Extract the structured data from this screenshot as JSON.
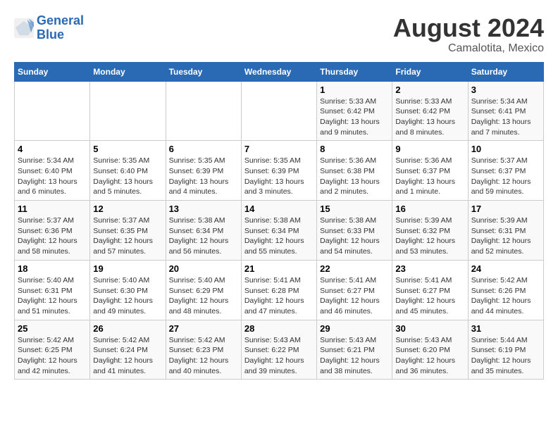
{
  "header": {
    "logo_line1": "General",
    "logo_line2": "Blue",
    "title": "August 2024",
    "subtitle": "Camalotita, Mexico"
  },
  "days_of_week": [
    "Sunday",
    "Monday",
    "Tuesday",
    "Wednesday",
    "Thursday",
    "Friday",
    "Saturday"
  ],
  "weeks": [
    [
      {
        "day": "",
        "info": ""
      },
      {
        "day": "",
        "info": ""
      },
      {
        "day": "",
        "info": ""
      },
      {
        "day": "",
        "info": ""
      },
      {
        "day": "1",
        "info": "Sunrise: 5:33 AM\nSunset: 6:42 PM\nDaylight: 13 hours\nand 9 minutes."
      },
      {
        "day": "2",
        "info": "Sunrise: 5:33 AM\nSunset: 6:42 PM\nDaylight: 13 hours\nand 8 minutes."
      },
      {
        "day": "3",
        "info": "Sunrise: 5:34 AM\nSunset: 6:41 PM\nDaylight: 13 hours\nand 7 minutes."
      }
    ],
    [
      {
        "day": "4",
        "info": "Sunrise: 5:34 AM\nSunset: 6:40 PM\nDaylight: 13 hours\nand 6 minutes."
      },
      {
        "day": "5",
        "info": "Sunrise: 5:35 AM\nSunset: 6:40 PM\nDaylight: 13 hours\nand 5 minutes."
      },
      {
        "day": "6",
        "info": "Sunrise: 5:35 AM\nSunset: 6:39 PM\nDaylight: 13 hours\nand 4 minutes."
      },
      {
        "day": "7",
        "info": "Sunrise: 5:35 AM\nSunset: 6:39 PM\nDaylight: 13 hours\nand 3 minutes."
      },
      {
        "day": "8",
        "info": "Sunrise: 5:36 AM\nSunset: 6:38 PM\nDaylight: 13 hours\nand 2 minutes."
      },
      {
        "day": "9",
        "info": "Sunrise: 5:36 AM\nSunset: 6:37 PM\nDaylight: 13 hours\nand 1 minute."
      },
      {
        "day": "10",
        "info": "Sunrise: 5:37 AM\nSunset: 6:37 PM\nDaylight: 12 hours\nand 59 minutes."
      }
    ],
    [
      {
        "day": "11",
        "info": "Sunrise: 5:37 AM\nSunset: 6:36 PM\nDaylight: 12 hours\nand 58 minutes."
      },
      {
        "day": "12",
        "info": "Sunrise: 5:37 AM\nSunset: 6:35 PM\nDaylight: 12 hours\nand 57 minutes."
      },
      {
        "day": "13",
        "info": "Sunrise: 5:38 AM\nSunset: 6:34 PM\nDaylight: 12 hours\nand 56 minutes."
      },
      {
        "day": "14",
        "info": "Sunrise: 5:38 AM\nSunset: 6:34 PM\nDaylight: 12 hours\nand 55 minutes."
      },
      {
        "day": "15",
        "info": "Sunrise: 5:38 AM\nSunset: 6:33 PM\nDaylight: 12 hours\nand 54 minutes."
      },
      {
        "day": "16",
        "info": "Sunrise: 5:39 AM\nSunset: 6:32 PM\nDaylight: 12 hours\nand 53 minutes."
      },
      {
        "day": "17",
        "info": "Sunrise: 5:39 AM\nSunset: 6:31 PM\nDaylight: 12 hours\nand 52 minutes."
      }
    ],
    [
      {
        "day": "18",
        "info": "Sunrise: 5:40 AM\nSunset: 6:31 PM\nDaylight: 12 hours\nand 51 minutes."
      },
      {
        "day": "19",
        "info": "Sunrise: 5:40 AM\nSunset: 6:30 PM\nDaylight: 12 hours\nand 49 minutes."
      },
      {
        "day": "20",
        "info": "Sunrise: 5:40 AM\nSunset: 6:29 PM\nDaylight: 12 hours\nand 48 minutes."
      },
      {
        "day": "21",
        "info": "Sunrise: 5:41 AM\nSunset: 6:28 PM\nDaylight: 12 hours\nand 47 minutes."
      },
      {
        "day": "22",
        "info": "Sunrise: 5:41 AM\nSunset: 6:27 PM\nDaylight: 12 hours\nand 46 minutes."
      },
      {
        "day": "23",
        "info": "Sunrise: 5:41 AM\nSunset: 6:27 PM\nDaylight: 12 hours\nand 45 minutes."
      },
      {
        "day": "24",
        "info": "Sunrise: 5:42 AM\nSunset: 6:26 PM\nDaylight: 12 hours\nand 44 minutes."
      }
    ],
    [
      {
        "day": "25",
        "info": "Sunrise: 5:42 AM\nSunset: 6:25 PM\nDaylight: 12 hours\nand 42 minutes."
      },
      {
        "day": "26",
        "info": "Sunrise: 5:42 AM\nSunset: 6:24 PM\nDaylight: 12 hours\nand 41 minutes."
      },
      {
        "day": "27",
        "info": "Sunrise: 5:42 AM\nSunset: 6:23 PM\nDaylight: 12 hours\nand 40 minutes."
      },
      {
        "day": "28",
        "info": "Sunrise: 5:43 AM\nSunset: 6:22 PM\nDaylight: 12 hours\nand 39 minutes."
      },
      {
        "day": "29",
        "info": "Sunrise: 5:43 AM\nSunset: 6:21 PM\nDaylight: 12 hours\nand 38 minutes."
      },
      {
        "day": "30",
        "info": "Sunrise: 5:43 AM\nSunset: 6:20 PM\nDaylight: 12 hours\nand 36 minutes."
      },
      {
        "day": "31",
        "info": "Sunrise: 5:44 AM\nSunset: 6:19 PM\nDaylight: 12 hours\nand 35 minutes."
      }
    ]
  ]
}
